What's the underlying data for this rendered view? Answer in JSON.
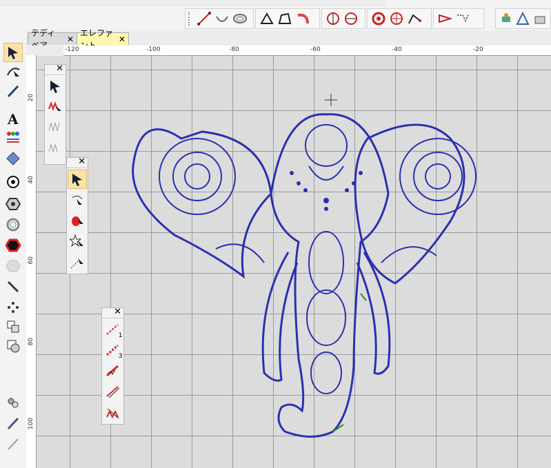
{
  "tabs": [
    {
      "label": "テディベア",
      "close": "✕"
    },
    {
      "label": "エレファント",
      "close": "✕"
    }
  ],
  "ruler": {
    "h_ticks": [
      "-120",
      "-100",
      "-80",
      "-60",
      "-40",
      "-20"
    ],
    "v_ticks": [
      "20",
      "40",
      "60",
      "80",
      "100"
    ]
  },
  "top_toolbar": {
    "groups": [
      [
        "line-icon",
        "curve-icon",
        "spiral-icon"
      ],
      [
        "node-edit-icon",
        "polygon-icon",
        "arc-icon"
      ],
      [
        "cut-icon",
        "split-icon"
      ],
      [
        "wheel-icon",
        "compass-icon",
        "vertex-icon"
      ],
      [
        "fold-icon",
        "puzzle-icon"
      ],
      [
        "satellite-icon",
        "scale-icon",
        "crane-icon"
      ]
    ]
  },
  "left_toolbar": [
    "select-arrow-icon",
    "reshape-icon",
    "pen-icon",
    "text-icon",
    "people-icon",
    "monogram-icon",
    "circle-icon",
    "hexagon-icon",
    "spiral-ring-icon",
    "red-hexagon-icon",
    "hex-plain-icon",
    "knife-icon",
    "dots-icon",
    "frame-icon",
    "shapes-icon",
    "pins-icon",
    "needle-icon",
    "pen2-icon"
  ],
  "panels": {
    "p1": {
      "close": "✕",
      "items": [
        "sel-icon",
        "zigzag-icon",
        "stitch-a-icon",
        "stitch-b-icon"
      ]
    },
    "p2": {
      "close": "✕",
      "items": [
        "arrow-icon",
        "rotate-icon",
        "paint-icon",
        "star-icon",
        "line-arrow-icon"
      ]
    },
    "p3": {
      "close": "✕",
      "items": [
        {
          "icon": "run1-icon",
          "label": "1"
        },
        {
          "icon": "run3-icon",
          "label": "3"
        },
        {
          "icon": "triple-icon",
          "label": ""
        },
        {
          "icon": "satin-icon",
          "label": ""
        },
        {
          "icon": "fill-icon",
          "label": ""
        }
      ]
    }
  }
}
